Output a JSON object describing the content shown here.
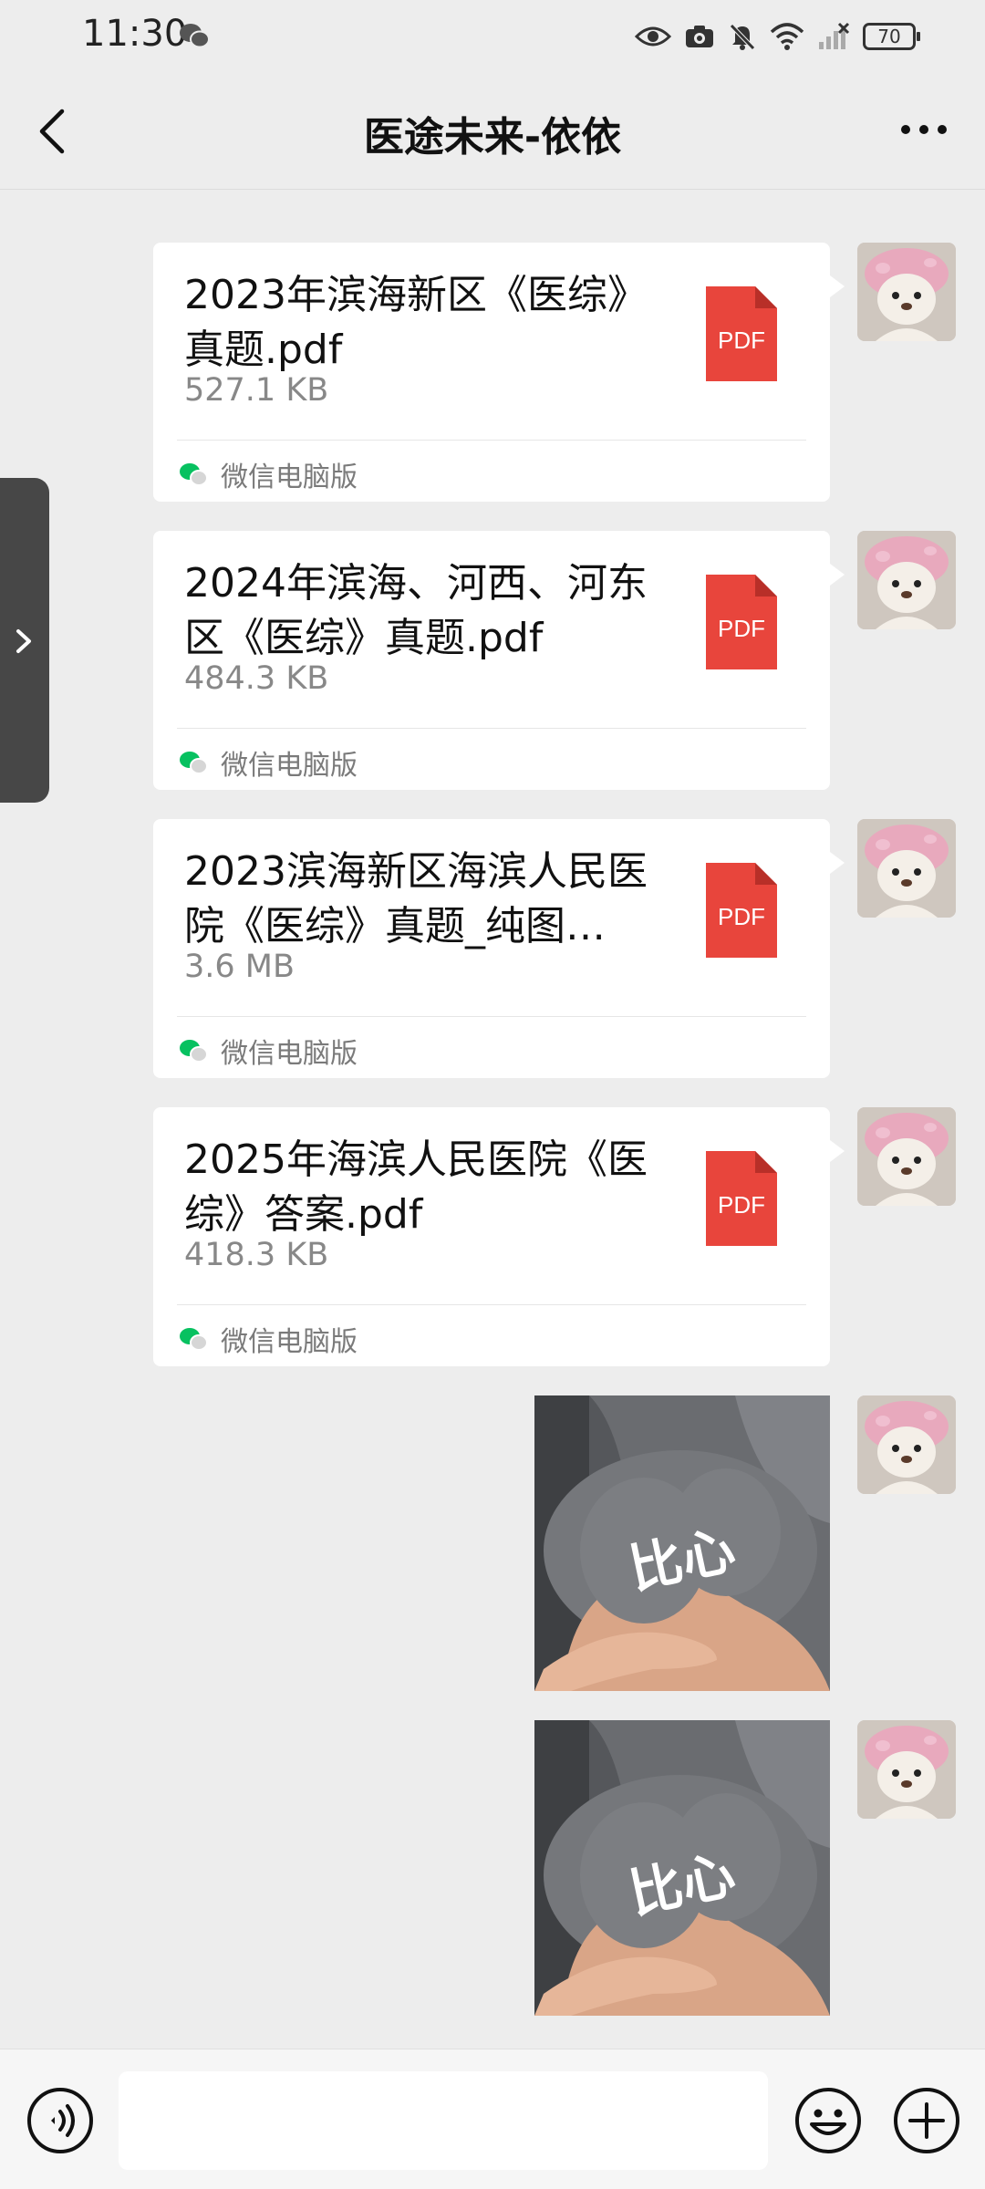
{
  "status_bar": {
    "time": "11:30",
    "battery": "70",
    "icons": [
      "wechat-notification-icon",
      "eye-icon",
      "camera-icon",
      "mute-bell-icon",
      "wifi-icon",
      "no-signal-icon",
      "battery-icon"
    ]
  },
  "header": {
    "title": "医途未来-依依",
    "back_icon": "chevron-left-icon",
    "more_icon": "more-dots-icon"
  },
  "messages": [
    {
      "type": "file",
      "name": "2023年滨海新区《医综》真题.pdf",
      "size": "527.1 KB",
      "badge": "PDF",
      "source": "微信电脑版"
    },
    {
      "type": "file",
      "name": "2024年滨海、河西、河东区《医综》真题.pdf",
      "size": "484.3 KB",
      "badge": "PDF",
      "source": "微信电脑版"
    },
    {
      "type": "file",
      "name": "2023滨海新区海滨人民医院《医综》真题_纯图…",
      "size": "3.6 MB",
      "badge": "PDF",
      "source": "微信电脑版"
    },
    {
      "type": "file",
      "name": "2025年海滨人民医院《医综》答案.pdf",
      "size": "418.3 KB",
      "badge": "PDF",
      "source": "微信电脑版"
    },
    {
      "type": "image",
      "caption": "比心"
    },
    {
      "type": "image",
      "caption": "比心"
    }
  ],
  "input_bar": {
    "placeholder": "",
    "voice_icon": "voice-icon",
    "emoji_icon": "emoji-icon",
    "plus_icon": "plus-icon"
  },
  "colors": {
    "background": "#ededed",
    "bubble": "#ffffff",
    "pdf_red": "#e8453c",
    "wechat_green": "#07c160"
  }
}
